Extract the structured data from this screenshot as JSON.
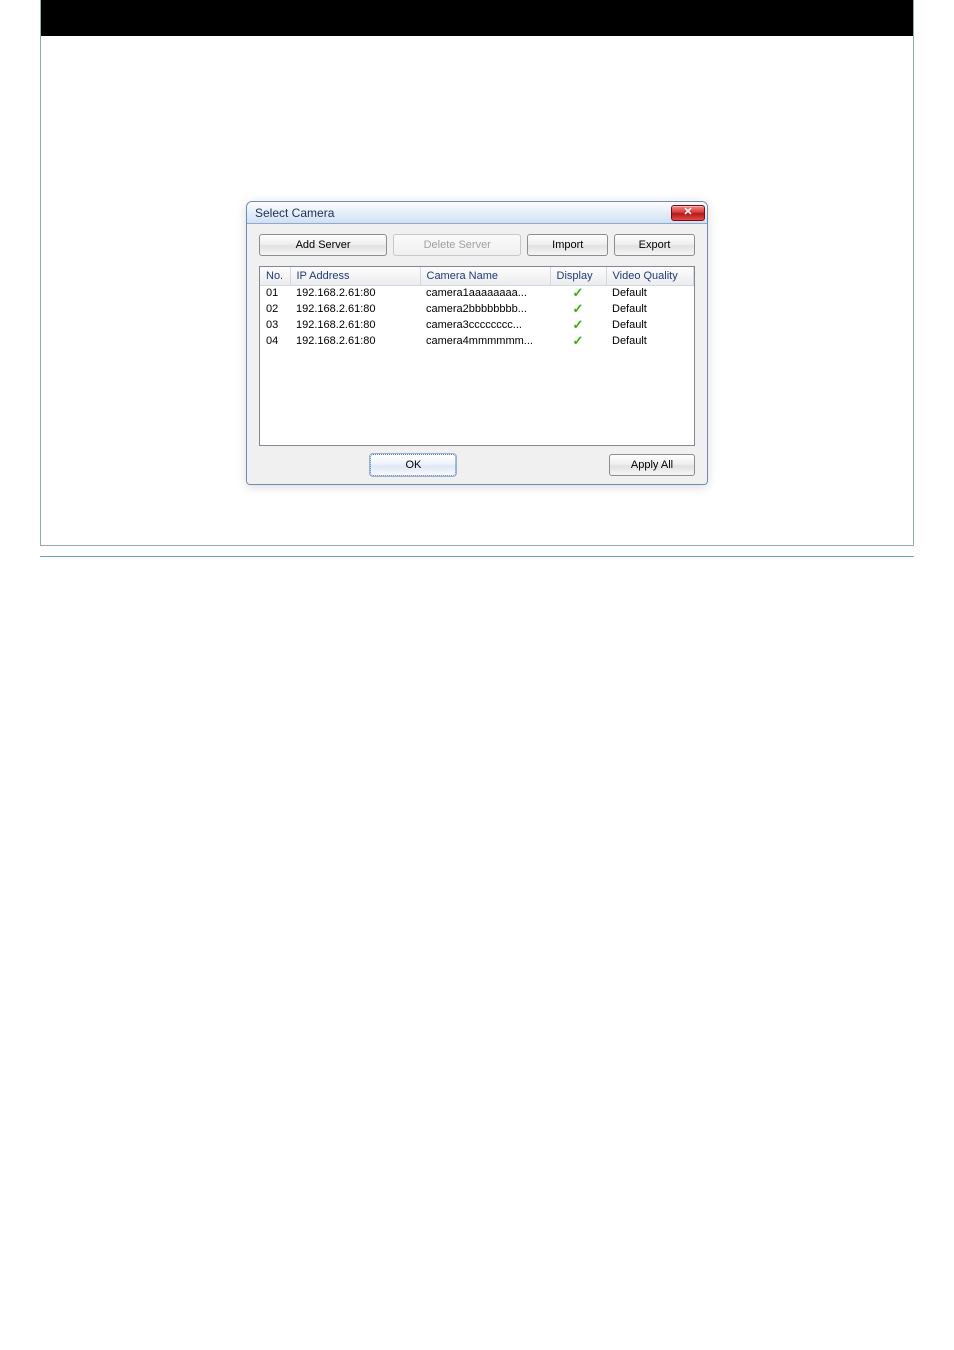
{
  "dialog": {
    "title": "Select Camera",
    "buttons": {
      "add_server": "Add Server",
      "delete_server": "Delete Server",
      "import": "Import",
      "export": "Export",
      "ok": "OK",
      "apply_all": "Apply All"
    },
    "columns": {
      "no": "No.",
      "ip": "IP Address",
      "camera_name": "Camera Name",
      "display": "Display",
      "video_quality": "Video Quality"
    },
    "rows": [
      {
        "no": "01",
        "ip": "192.168.2.61:80",
        "name": "camera1aaaaaaaa...",
        "display": true,
        "quality": "Default"
      },
      {
        "no": "02",
        "ip": "192.168.2.61:80",
        "name": "camera2bbbbbbbb...",
        "display": true,
        "quality": "Default"
      },
      {
        "no": "03",
        "ip": "192.168.2.61:80",
        "name": "camera3cccccccc...",
        "display": true,
        "quality": "Default"
      },
      {
        "no": "04",
        "ip": "192.168.2.61:80",
        "name": "camera4mmmmmm...",
        "display": true,
        "quality": "Default"
      }
    ]
  }
}
